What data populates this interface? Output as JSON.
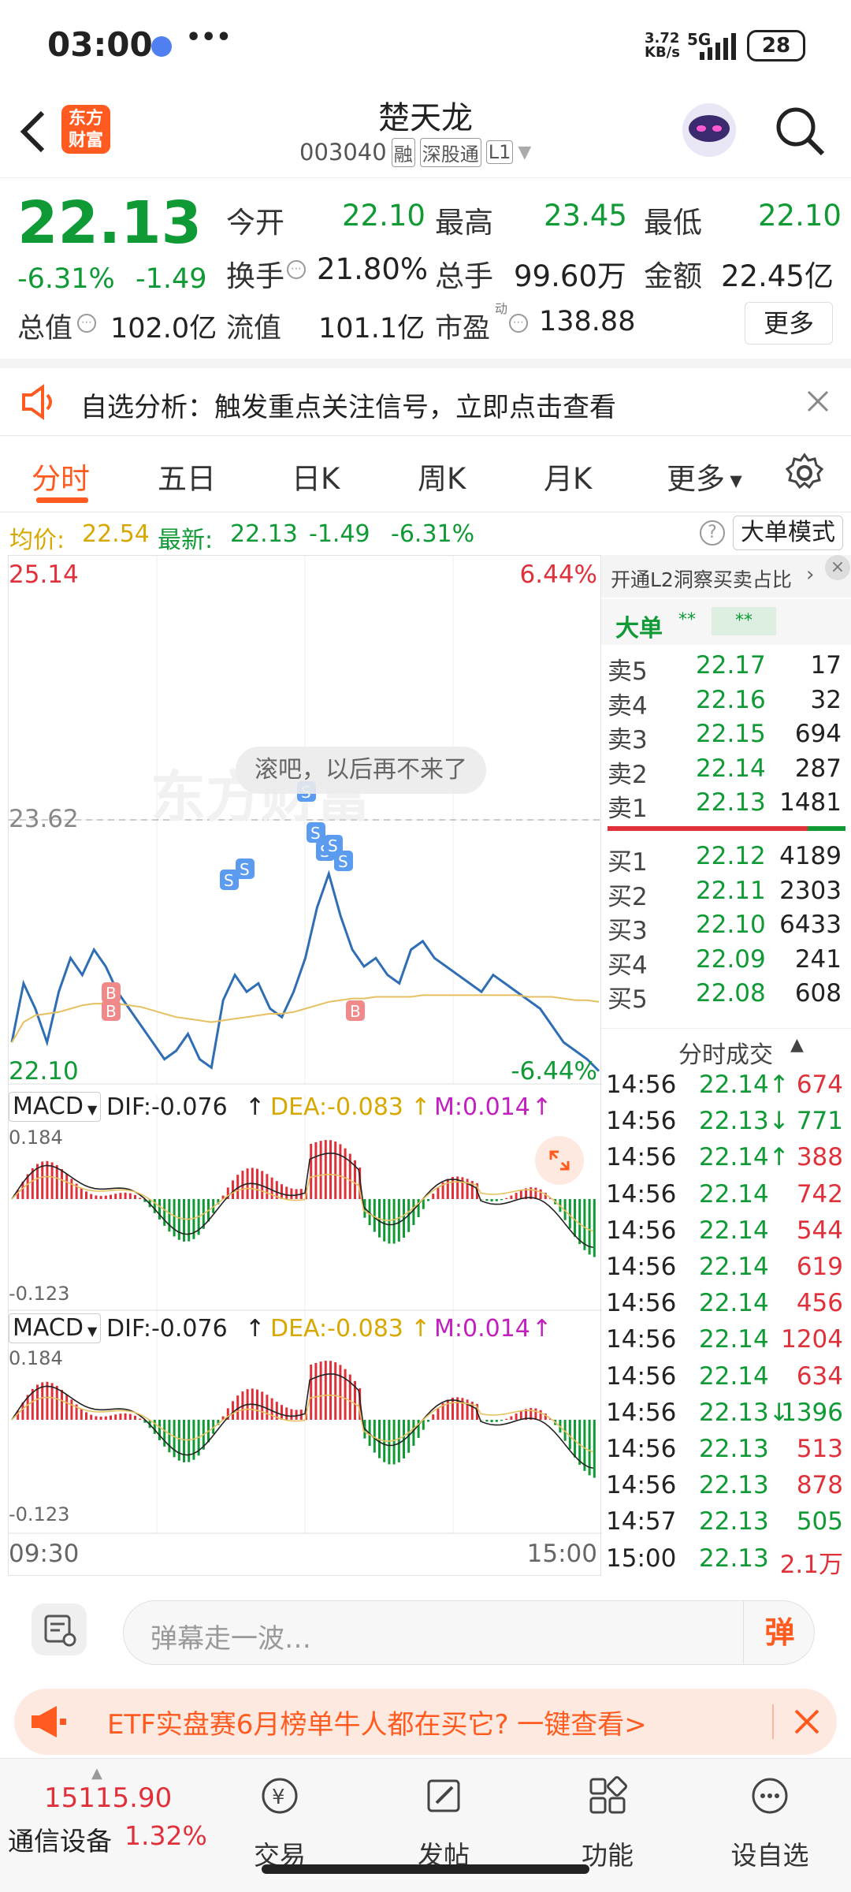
{
  "status_bar": {
    "time": "03:00",
    "dots": "•••",
    "speed_top": "3.72",
    "speed_bottom": "KB/s",
    "network": "5G",
    "battery": "28"
  },
  "header": {
    "back_icon": "chevron-left-icon",
    "logo_line1": "东方",
    "logo_line2": "财富",
    "title": "楚天龙",
    "code": "003040",
    "tag_rong": "融",
    "tag_sgt": "深股通",
    "tag_level": "L1"
  },
  "quote": {
    "price": "22.13",
    "pct_change": "-6.31%",
    "change": "-1.49",
    "open_label": "今开",
    "open": "22.10",
    "high_label": "最高",
    "high": "23.45",
    "low_label": "最低",
    "low": "22.10",
    "turnover_label": "换手",
    "turnover": "21.80%",
    "volume_label": "总手",
    "volume": "99.60万",
    "amount_label": "金额",
    "amount": "22.45亿",
    "mktcap_label": "总值",
    "mktcap": "102.0亿",
    "float_label": "流值",
    "float": "101.1亿",
    "pe_label": "市盈",
    "pe_sup": "动",
    "pe": "138.88",
    "more_label": "更多"
  },
  "banner": {
    "text": "自选分析：触发重点关注信号，立即点击查看"
  },
  "tabs": {
    "items": [
      "分时",
      "五日",
      "日K",
      "周K",
      "月K",
      "更多"
    ],
    "active": "分时"
  },
  "info_line": {
    "avg_label": "均价:",
    "avg": "22.54",
    "latest_label": "最新:",
    "latest": "22.13",
    "change": "-1.49",
    "pct": "-6.31%",
    "mode_button": "大单模式"
  },
  "chart_labels": {
    "top_price": "25.14",
    "top_pct": "6.44%",
    "mid_price": "23.62",
    "bottom_price": "22.10",
    "bottom_pct": "-6.44%",
    "watermark": "东方财富",
    "bullet": "滚吧，以后再不来了",
    "time_start": "09:30",
    "time_end": "15:00"
  },
  "macd": {
    "panel1": {
      "select": "MACD",
      "dif": "DIF:-0.076",
      "dea": "DEA:-0.083",
      "m": "M:0.014",
      "ytop": "0.184",
      "ybot": "-0.123"
    },
    "panel2": {
      "select": "MACD",
      "dif": "DIF:-0.076",
      "dea": "DEA:-0.083",
      "m": "M:0.014",
      "ytop": "0.184",
      "ybot": "-0.123"
    }
  },
  "chart_data": {
    "type": "line",
    "title": "",
    "x_range": [
      "09:30",
      "15:00"
    ],
    "ylim": [
      22.1,
      25.14
    ],
    "series": [
      {
        "values": [
          22.3,
          22.65,
          22.5,
          22.3,
          22.6,
          22.8,
          22.7,
          22.85,
          22.75,
          22.6,
          22.5,
          22.4,
          22.3,
          22.2,
          22.25,
          22.35,
          22.2,
          22.15,
          22.55,
          22.7,
          22.6,
          22.65,
          22.5,
          22.45,
          22.6,
          22.8,
          23.1,
          23.3,
          23.05,
          22.85,
          22.75,
          22.8,
          22.7,
          22.65,
          22.85,
          22.9,
          22.8,
          22.75,
          22.7,
          22.65,
          22.6,
          22.7,
          22.65,
          22.6,
          22.55,
          22.5,
          22.4,
          22.3,
          22.25,
          22.2,
          22.13
        ]
      },
      {
        "values": [
          22.3,
          22.42,
          22.46,
          22.47,
          22.48,
          22.5,
          22.52,
          22.53,
          22.53,
          22.53,
          22.52,
          22.51,
          22.49,
          22.47,
          22.45,
          22.44,
          22.43,
          22.42,
          22.43,
          22.44,
          22.45,
          22.46,
          22.47,
          22.47,
          22.48,
          22.5,
          22.52,
          22.54,
          22.55,
          22.56,
          22.56,
          22.57,
          22.57,
          22.57,
          22.57,
          22.58,
          22.58,
          22.58,
          22.58,
          22.58,
          22.58,
          22.58,
          22.58,
          22.58,
          22.57,
          22.57,
          22.57,
          22.56,
          22.55,
          22.55,
          22.54
        ]
      }
    ],
    "markers": [
      {
        "label": "B"
      },
      {
        "label": "B"
      },
      {
        "label": "B"
      },
      {
        "label": "S"
      },
      {
        "label": "S"
      },
      {
        "label": "S"
      },
      {
        "label": "S"
      },
      {
        "label": "S"
      },
      {
        "label": "S"
      },
      {
        "label": "S"
      }
    ]
  },
  "side_panel": {
    "header": "开通L2洞察买卖占比",
    "big_order_label": "大单",
    "big_order_v1": "**",
    "big_order_v2": "**",
    "asks": [
      {
        "label": "卖5",
        "price": "22.17",
        "vol": "17"
      },
      {
        "label": "卖4",
        "price": "22.16",
        "vol": "32"
      },
      {
        "label": "卖3",
        "price": "22.15",
        "vol": "694"
      },
      {
        "label": "卖2",
        "price": "22.14",
        "vol": "287"
      },
      {
        "label": "卖1",
        "price": "22.13",
        "vol": "1481"
      }
    ],
    "bids": [
      {
        "label": "买1",
        "price": "22.12",
        "vol": "4189"
      },
      {
        "label": "买2",
        "price": "22.11",
        "vol": "2303"
      },
      {
        "label": "买3",
        "price": "22.10",
        "vol": "6433"
      },
      {
        "label": "买4",
        "price": "22.09",
        "vol": "241"
      },
      {
        "label": "买5",
        "price": "22.08",
        "vol": "608"
      }
    ],
    "trades_title": "分时成交",
    "trades": [
      {
        "time": "14:56",
        "price": "22.14↑",
        "vol": "674"
      },
      {
        "time": "14:56",
        "price": "22.13↓",
        "vol": "771"
      },
      {
        "time": "14:56",
        "price": "22.14↑",
        "vol": "388"
      },
      {
        "time": "14:56",
        "price": "22.14",
        "vol": "742"
      },
      {
        "time": "14:56",
        "price": "22.14",
        "vol": "544"
      },
      {
        "time": "14:56",
        "price": "22.14",
        "vol": "619"
      },
      {
        "time": "14:56",
        "price": "22.14",
        "vol": "456"
      },
      {
        "time": "14:56",
        "price": "22.14",
        "vol": "1204"
      },
      {
        "time": "14:56",
        "price": "22.14",
        "vol": "634"
      },
      {
        "time": "14:56",
        "price": "22.13↓",
        "vol": "1396"
      },
      {
        "time": "14:56",
        "price": "22.13",
        "vol": "513"
      },
      {
        "time": "14:56",
        "price": "22.13",
        "vol": "878"
      },
      {
        "time": "14:57",
        "price": "22.13",
        "vol": "505"
      },
      {
        "time": "15:00",
        "price": "22.13",
        "vol": "2.1万"
      }
    ]
  },
  "danmu": {
    "placeholder": "弹幕走一波…",
    "send_label": "弹"
  },
  "promo": {
    "text": "ETF实盘赛6月榜单牛人都在买它? 一键查看>"
  },
  "bottom_nav": {
    "index_value": "15115.90",
    "index_name": "通信设备",
    "index_pct": "1.32%",
    "items": [
      "交易",
      "发帖",
      "功能",
      "设自选"
    ]
  },
  "colors": {
    "up": "#e0313b",
    "down": "#0f9a35",
    "accent": "#ff5a1f",
    "price_line": "#2f6db5",
    "avg_line": "#e6c060"
  }
}
